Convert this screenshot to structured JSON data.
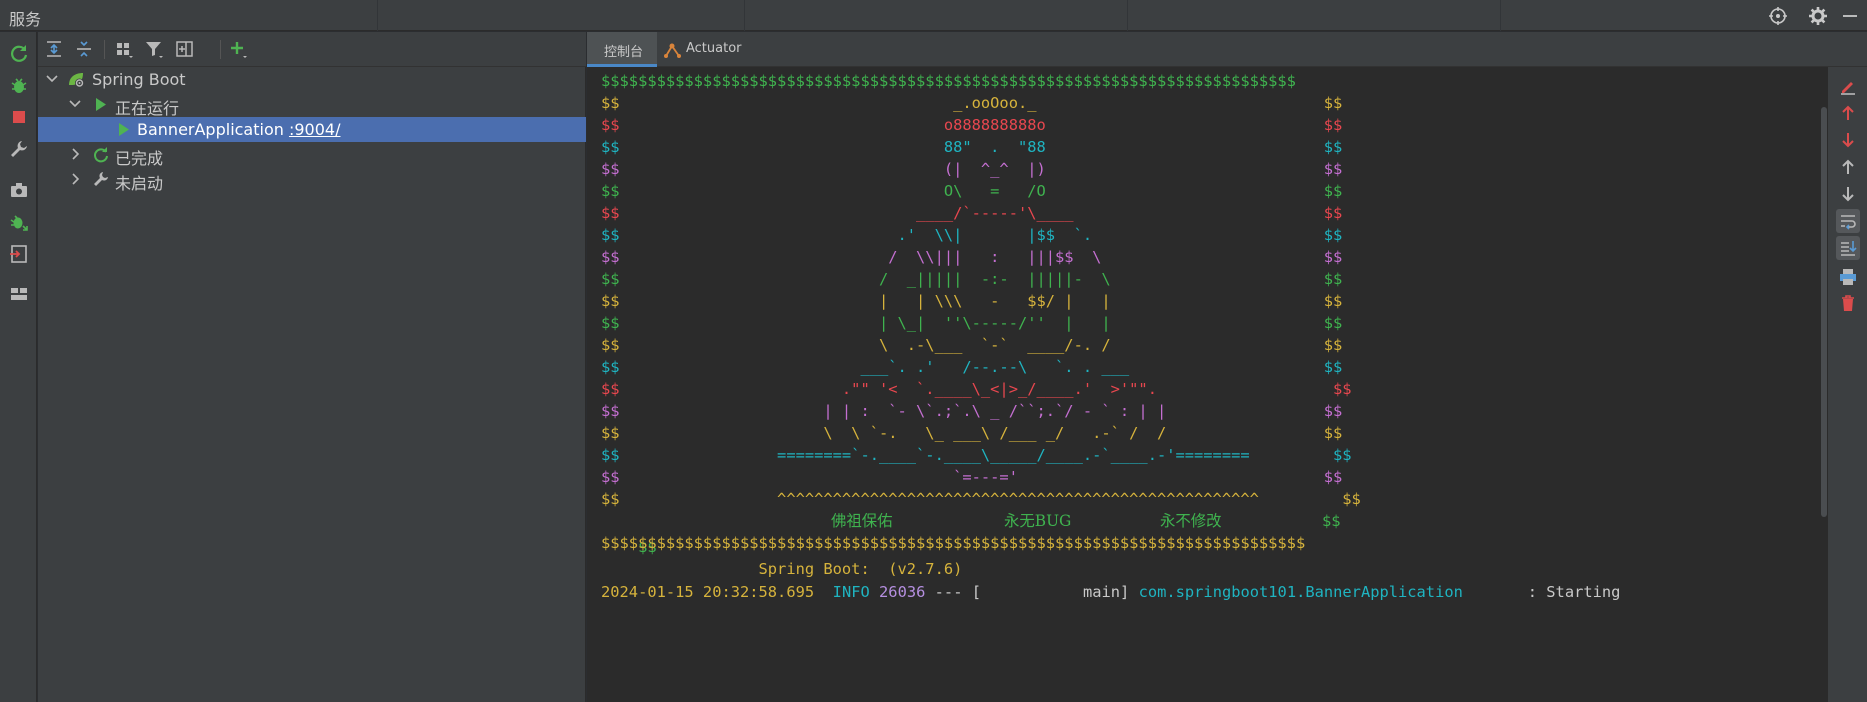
{
  "window": {
    "title": "服务"
  },
  "tree": {
    "root_label": "Spring Boot",
    "running_label": "正在运行",
    "app_name": "BannerApplication",
    "app_port": ":9004/",
    "finished_label": "已完成",
    "not_started_label": "未启动"
  },
  "tabs": [
    {
      "label": "控制台"
    },
    {
      "label": "Actuator"
    }
  ],
  "console": {
    "colors": {
      "green": "#3fb34f",
      "red": "#e8474f",
      "cyan": "#1fb4c1",
      "magenta": "#c46fd1",
      "yellow": "#d6b33c",
      "plain": "#c9c9c9",
      "blue": "#4aa2e0",
      "purple": "#b58fe0"
    },
    "banner": [
      {
        "text": "$$$$$$$$$$$$$$$$$$$$$$$$$$$$$$$$$$$$$$$$$$$$$$$$$$$$$$$$$$$$$$$$$$$$$$$$$$$",
        "color": "green"
      },
      {
        "text": "$$                                    _.ooOoo._                               $$",
        "color": "yellow"
      },
      {
        "text": "$$                                   o888888888o                              $$",
        "color": "red"
      },
      {
        "text": "$$                                   88\"  .  \"88                              $$",
        "color": "cyan"
      },
      {
        "text": "$$                                   (|  ^_^  |)                              $$",
        "color": "magenta"
      },
      {
        "text": "$$                                   O\\   =   /O                              $$",
        "color": "green"
      },
      {
        "text": "$$                                ____/`-----'\\____                           $$",
        "color": "red"
      },
      {
        "text": "$$                              .'  \\\\|       |$$  `.                         $$",
        "color": "cyan"
      },
      {
        "text": "$$                             /  \\\\|||   :   |||$$  \\                        $$",
        "color": "magenta"
      },
      {
        "text": "$$                            /  _|||||  -:-  |||||-  \\                       $$",
        "color": "green"
      },
      {
        "text": "$$                            |   | \\\\\\   -   $$/ |   |                       $$",
        "color": "yellow"
      },
      {
        "text": "$$                            | \\_|  ''\\-----/''  |   |                       $$",
        "color": "green"
      },
      {
        "text": "$$                            \\  .-\\___  `-`  ____/-. /                       $$",
        "color": "yellow"
      },
      {
        "text": "$$                          ___`. .'   /--.--\\   `. . ___                     $$",
        "color": "cyan"
      },
      {
        "text": "$$                        .\"\" '<  `.____\\_<|>_/____.'  >'\"\".                   $$",
        "color": "red"
      },
      {
        "text": "$$                      | | :  `- \\`.;`.\\ _ /``;.`/ - ` : | |                 $$",
        "color": "magenta"
      },
      {
        "text": "$$                      \\  \\ `-.   \\_ ___\\ /___ _/   .-` /  /                 $$",
        "color": "yellow"
      },
      {
        "text": "$$                 ========`-.____`-.____\\_____/____.-`____.-'========         $$",
        "color": "cyan"
      },
      {
        "text": "$$                                    `=---='                                 $$",
        "color": "magenta"
      },
      {
        "text": "$$                 ^^^^^^^^^^^^^^^^^^^^^^^^^^^^^^^^^^^^^^^^^^^^^^^^^^^^         $$",
        "color": "yellow"
      }
    ],
    "blessing": {
      "prefix": "$$",
      "buddha": "佛祖保佑",
      "nobug": "永无BUG",
      "nochange": "永不修改",
      "suffix": "$$",
      "color": "green"
    },
    "bottom_border": {
      "text": "$$$$$$$$$$$$$$$$$$$$$$$$$$$$$$$$$$$$$$$$$$$$$$$$$$$$$$$$$$$$$$$$$$$$$$$$$$$$",
      "color": "yellow"
    },
    "boot_line": {
      "text": "                 Spring Boot:  (v2.7.6)",
      "color": "yellow"
    },
    "log": {
      "timestamp": "2024-01-15 20:32:58.695",
      "level": "INFO",
      "pid": "26036",
      "dashes": "---",
      "thread": "[           main]",
      "logger": "com.springboot101.BannerApplication",
      "message": ": Starting"
    }
  }
}
